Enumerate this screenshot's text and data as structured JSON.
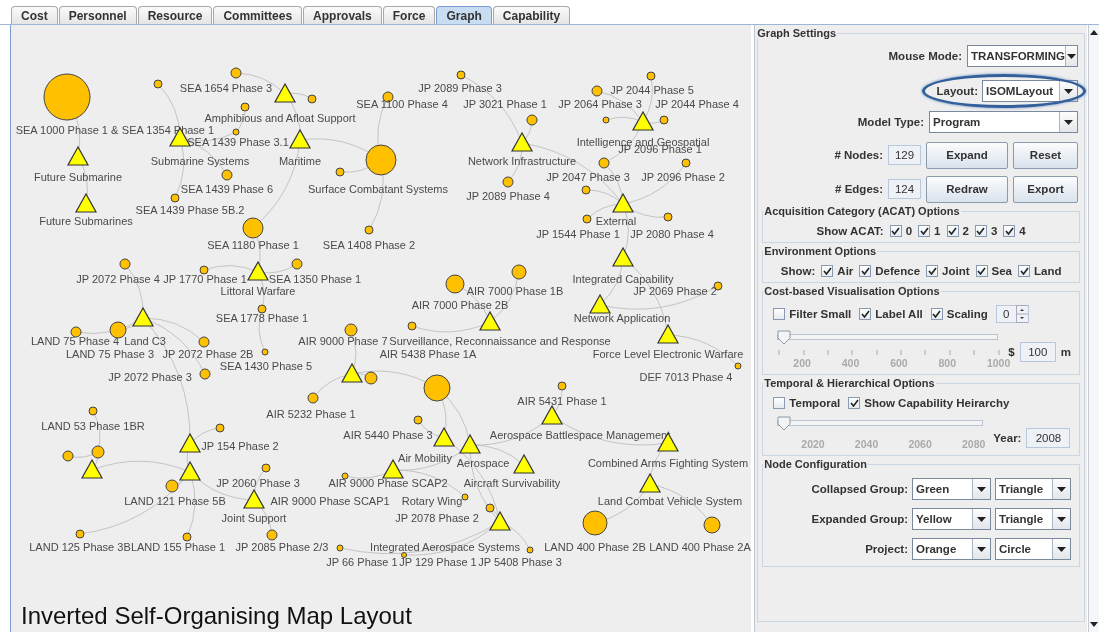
{
  "tabs": [
    {
      "label": "Cost",
      "selected": false
    },
    {
      "label": "Personnel",
      "selected": false
    },
    {
      "label": "Resource",
      "selected": false
    },
    {
      "label": "Committees",
      "selected": false
    },
    {
      "label": "Approvals",
      "selected": false
    },
    {
      "label": "Force",
      "selected": false
    },
    {
      "label": "Graph",
      "selected": true
    },
    {
      "label": "Capability",
      "selected": false
    }
  ],
  "graph": {
    "nodes": [
      {
        "kind": "project"
      },
      {
        "kind": "project",
        "label": "SEA 1654 Phase 3"
      },
      {
        "kind": "project",
        "label": "JP 2089 Phase 3"
      },
      {
        "kind": "project",
        "label": "JP 2044 Phase 5"
      },
      {
        "kind": "expanded_group"
      },
      {
        "kind": "project"
      },
      {
        "kind": "project",
        "label": "SEA 1100 Phase 4"
      },
      {
        "kind": "project",
        "label": "JP 3021 Phase 1"
      },
      {
        "kind": "project",
        "label": "JP 2064 Phase 3"
      },
      {
        "kind": "project",
        "label": "JP 2044 Phase 4"
      },
      {
        "kind": "project",
        "label": "Amphibious and Afloat Support"
      },
      {
        "kind": "project",
        "label": "SEA 1000 Phase 1 &"
      },
      {
        "kind": "project",
        "label": "SEA 1354 Phase 1"
      },
      {
        "kind": "project",
        "label": "SEA 1439 Phase 3.1"
      },
      {
        "kind": "expanded_group",
        "label": "Intelligence and Geospatial"
      },
      {
        "kind": "project",
        "label": "JP 2096 Phase 1"
      },
      {
        "kind": "expanded_group",
        "label": "Submarine Systems"
      },
      {
        "kind": "expanded_group",
        "label": "Maritime"
      },
      {
        "kind": "expanded_group",
        "label": "Network Infrastructure"
      },
      {
        "kind": "project"
      },
      {
        "kind": "expanded_group",
        "label": "Future Submarine"
      },
      {
        "kind": "project",
        "label": "JP 2047 Phase 3"
      },
      {
        "kind": "project",
        "label": "JP 2096 Phase 2"
      },
      {
        "kind": "project",
        "label": "SEA 1439 Phase 6"
      },
      {
        "kind": "project",
        "label": "Surface Combatant Systems"
      },
      {
        "kind": "project",
        "label": "JP 2089 Phase 4"
      },
      {
        "kind": "project",
        "label": "SEA 1439 Phase 5B.2"
      },
      {
        "kind": "expanded_group",
        "label": "Future Submarines"
      },
      {
        "kind": "expanded_group",
        "label": "External"
      },
      {
        "kind": "project",
        "label": "JP 1544 Phase 1"
      },
      {
        "kind": "project",
        "label": "JP 2080 Phase 4"
      },
      {
        "kind": "project",
        "label": "SEA 1180 Phase 1"
      },
      {
        "kind": "project",
        "label": "SEA 1408 Phase 2"
      },
      {
        "kind": "project",
        "label": "JP 2072 Phase 4"
      },
      {
        "kind": "project",
        "label": "JP 1770 Phase 1"
      },
      {
        "kind": "project",
        "label": "SEA 1350 Phase 1"
      },
      {
        "kind": "project"
      },
      {
        "kind": "expanded_group",
        "label": "Integrated Capability"
      },
      {
        "kind": "expanded_group",
        "label": "Littoral Warfare"
      },
      {
        "kind": "project",
        "label": "AIR 7000 Phase 1B"
      },
      {
        "kind": "project",
        "label": "JP 2069 Phase 2"
      },
      {
        "kind": "expanded_group",
        "label": "AIR 7000 Phase 2B"
      },
      {
        "kind": "project",
        "label": "SEA 1778 Phase 1"
      },
      {
        "kind": "expanded_group",
        "label": "Network Application"
      },
      {
        "kind": "project",
        "label": "LAND 75 Phase 4"
      },
      {
        "kind": "expanded_group",
        "label": "Land C3"
      },
      {
        "kind": "project",
        "label": "AIR 9000 Phase 7"
      },
      {
        "kind": "project",
        "label": "Surveillance, Reconnaissance and Response"
      },
      {
        "kind": "project",
        "label": "LAND 75 Phase 3"
      },
      {
        "kind": "project",
        "label": "JP 2072 Phase 2B"
      },
      {
        "kind": "project",
        "label": "AIR 5438 Phase 1A"
      },
      {
        "kind": "expanded_group",
        "label": "Force Level Electronic Warfare"
      },
      {
        "kind": "project",
        "label": "SEA 1430 Phase 5"
      },
      {
        "kind": "expanded_group"
      },
      {
        "kind": "project",
        "label": "JP 2072 Phase 3"
      },
      {
        "kind": "project",
        "label": "DEF 7013 Phase 4"
      },
      {
        "kind": "project"
      },
      {
        "kind": "project",
        "label": "AIR 5431 Phase 1"
      },
      {
        "kind": "project",
        "label": "AIR 5232 Phase 1"
      },
      {
        "kind": "project"
      },
      {
        "kind": "project",
        "label": "LAND 53 Phase 1BR"
      },
      {
        "kind": "project",
        "label": "AIR 5440 Phase 3"
      },
      {
        "kind": "expanded_group",
        "label": "Aerospace Battlespace Management"
      },
      {
        "kind": "expanded_group",
        "label": "JP 154 Phase 2"
      },
      {
        "kind": "project"
      },
      {
        "kind": "project"
      },
      {
        "kind": "expanded_group",
        "label": "Air Mobility"
      },
      {
        "kind": "expanded_group",
        "label": "Aerospace"
      },
      {
        "kind": "expanded_group",
        "label": "Combined Arms Fighting System"
      },
      {
        "kind": "expanded_group"
      },
      {
        "kind": "expanded_group"
      },
      {
        "kind": "project",
        "label": "JP 2060 Phase 3"
      },
      {
        "kind": "expanded_group",
        "label": "AIR 9000 Phase SCAP2"
      },
      {
        "kind": "expanded_group",
        "label": "Aircraft Survivability"
      },
      {
        "kind": "project",
        "label": "LAND 121 Phase 5B"
      },
      {
        "kind": "project",
        "label": "AIR 9000 Phase SCAP1"
      },
      {
        "kind": "project",
        "label": "Rotary Wing"
      },
      {
        "kind": "expanded_group",
        "label": "Land Combat Vehicle System"
      },
      {
        "kind": "expanded_group",
        "label": "Joint Support"
      },
      {
        "kind": "project",
        "label": "JP 2078 Phase 2"
      },
      {
        "kind": "project",
        "label": "LAND 125 Phase 3B"
      },
      {
        "kind": "project",
        "label": "LAND 155 Phase 1"
      },
      {
        "kind": "project",
        "label": "JP 2085 Phase 2/3"
      },
      {
        "kind": "expanded_group",
        "label": "Integrated Aerospace Systems"
      },
      {
        "kind": "project",
        "label": "LAND 400 Phase 2B"
      },
      {
        "kind": "project",
        "label": "LAND 400 Phase 2A"
      },
      {
        "kind": "project",
        "label": "JP 66 Phase 1"
      },
      {
        "kind": "project",
        "label": "JP 129 Phase 1"
      },
      {
        "kind": "project",
        "label": "JP 5408 Phase 3"
      }
    ],
    "caption": "Inverted Self-Organising Map Layout"
  },
  "settings": {
    "title": "Graph Settings",
    "mouse_mode": {
      "label": "Mouse Mode:",
      "value": "TRANSFORMING"
    },
    "layout": {
      "label": "Layout:",
      "value": "ISOMLayout",
      "highlighted": true
    },
    "model_type": {
      "label": "Model Type:",
      "value": "Program"
    },
    "counts": [
      {
        "label": "# Nodes:",
        "value": "129",
        "buttons": [
          "Expand",
          "Reset"
        ]
      },
      {
        "label": "# Edges:",
        "value": "124",
        "buttons": [
          "Redraw",
          "Export"
        ]
      }
    ],
    "acat": {
      "title": "Acquisition Category (ACAT) Options",
      "label": "Show ACAT:",
      "options": [
        {
          "label": "0",
          "checked": true
        },
        {
          "label": "1",
          "checked": true
        },
        {
          "label": "2",
          "checked": true
        },
        {
          "label": "3",
          "checked": true
        },
        {
          "label": "4",
          "checked": true
        }
      ]
    },
    "environment": {
      "title": "Environment Options",
      "label": "Show:",
      "options": [
        {
          "label": "Air",
          "checked": true
        },
        {
          "label": "Defence",
          "checked": true
        },
        {
          "label": "Joint",
          "checked": true
        },
        {
          "label": "Sea",
          "checked": true
        },
        {
          "label": "Land",
          "checked": true
        }
      ]
    },
    "cost": {
      "title": "Cost-based Visualisation Options",
      "options": [
        {
          "label": "Filter Small",
          "checked": false
        },
        {
          "label": "Label All",
          "checked": true
        },
        {
          "label": "Scaling",
          "checked": true
        }
      ],
      "spinner": "0",
      "slider": {
        "level": 0,
        "ticks": [
          "200",
          "400",
          "600",
          "800",
          "1000"
        ]
      },
      "currency": "$",
      "amount": "100",
      "unit": "m"
    },
    "temporal": {
      "title": "Temporal & Hierarchical Options",
      "options": [
        {
          "label": "Temporal",
          "checked": false
        },
        {
          "label": "Show Capability Heirarchy",
          "checked": true
        }
      ],
      "slider": {
        "level": 0,
        "ticks": [
          "2020",
          "2040",
          "2060",
          "2080"
        ]
      },
      "year_label": "Year:",
      "year": "2008"
    },
    "node_config": {
      "title": "Node Configuration",
      "rows": [
        {
          "label": "Collapsed Group:",
          "color_option": "Green",
          "shape_option": "Triangle"
        },
        {
          "label": "Expanded Group:",
          "color_option": "Yellow",
          "shape_option": "Triangle"
        },
        {
          "label": "Project:",
          "color_option": "Orange",
          "shape_option": "Circle"
        }
      ]
    }
  }
}
